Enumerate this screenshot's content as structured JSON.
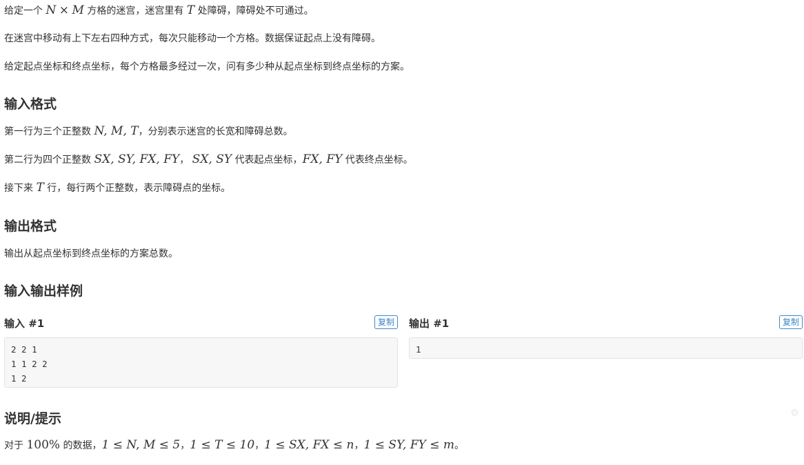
{
  "description": {
    "line1": {
      "t1": "给定一个",
      "m1": "N",
      "times": "×",
      "m2": "M",
      "t2": "方格的迷宫，迷宫里有",
      "m3": "T",
      "t3": "处障碍，障碍处不可通过。"
    },
    "line2": "在迷宫中移动有上下左右四种方式，每次只能移动一个方格。数据保证起点上没有障碍。",
    "line3": "给定起点坐标和终点坐标，每个方格最多经过一次，问有多少种从起点坐标到终点坐标的方案。"
  },
  "input_format": {
    "heading": "输入格式",
    "line1": {
      "t1": "第一行为三个正整数",
      "math": "N, M, T",
      "t2": "，分别表示迷宫的长宽和障碍总数。"
    },
    "line2": {
      "t1": "第二行为四个正整数",
      "math1": "SX, SY, FX, FY",
      "t2": "，",
      "math2": "SX, SY",
      "t3": "代表起点坐标，",
      "math3": "FX, FY",
      "t4": "代表终点坐标。"
    },
    "line3": {
      "t1": "接下来",
      "math": "T",
      "t2": "行，每行两个正整数，表示障碍点的坐标。"
    }
  },
  "output_format": {
    "heading": "输出格式",
    "line1": "输出从起点坐标到终点坐标的方案总数。"
  },
  "samples": {
    "heading": "输入输出样例",
    "input_title": "输入 #1",
    "output_title": "输出 #1",
    "copy_label": "复制",
    "input_lines": [
      "2 2 1",
      "1 1 2 2",
      "1 2"
    ],
    "output_lines": [
      "1"
    ]
  },
  "hint": {
    "heading": "说明/提示",
    "t1": "对于",
    "pct": "100%",
    "t2": "的数据，",
    "c1": "1 ≤ N, M ≤ 5",
    "sep1": "，",
    "c2": "1 ≤ T ≤ 10",
    "sep2": "，",
    "c3": "1 ≤ SX, FX ≤ n",
    "sep3": "，",
    "c4": "1 ≤ SY, FY ≤ m",
    "end": "。"
  },
  "icons": {
    "faint_corner": "settings-gear-icon"
  }
}
